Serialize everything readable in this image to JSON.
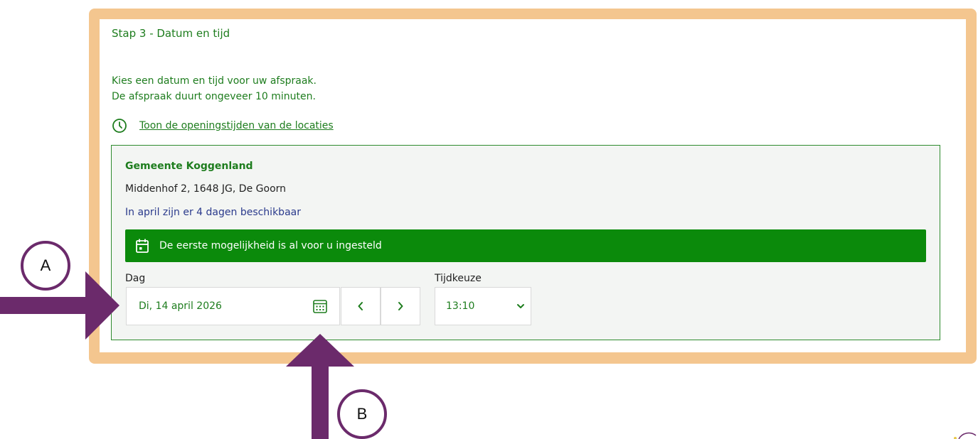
{
  "step_title": "Stap 3 - Datum en tijd",
  "intro": {
    "line1": "Kies een datum en tijd voor uw afspraak.",
    "line2": "De afspraak duurt ongeveer 10 minuten."
  },
  "opening_hours_link": "Toon de openingstijden van de locaties",
  "location": {
    "name": "Gemeente Koggenland",
    "address": "Middenhof 2, 1648 JG, De Goorn",
    "availability": "In april zijn er 4 dagen beschikbaar"
  },
  "banner": {
    "text": "De eerste mogelijkheid is al voor u ingesteld",
    "color": "#0b8a0b"
  },
  "day": {
    "label": "Dag",
    "value": "Di, 14 april 2026"
  },
  "time": {
    "label": "Tijdkeuze",
    "value": "13:10"
  },
  "annotations": {
    "a_label": "A",
    "b_label": "B",
    "arrow_color": "#6b2a6b"
  },
  "colors": {
    "frame": "#f4c68f",
    "accent_green": "#1e7d1e"
  }
}
